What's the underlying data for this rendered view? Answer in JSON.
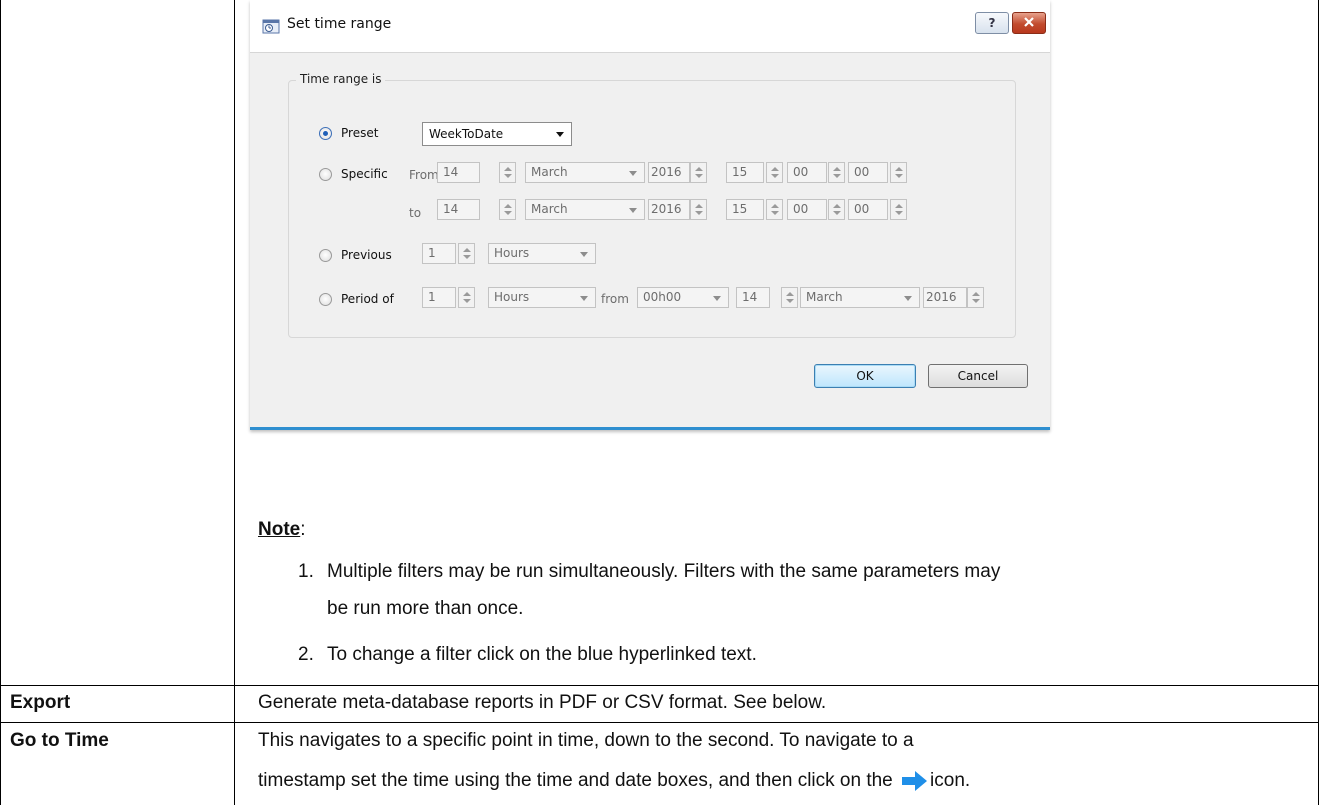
{
  "dialog": {
    "title": "Set time range",
    "group_title": "Time range is",
    "preset": {
      "label": "Preset",
      "value": "WeekToDate",
      "selected": true
    },
    "specific": {
      "label": "Specific",
      "from_label": "From",
      "to_label": "to",
      "from": {
        "day": "14",
        "month": "March",
        "year": "2016",
        "hour": "15",
        "minute": "00",
        "second": "00"
      },
      "to": {
        "day": "14",
        "month": "March",
        "year": "2016",
        "hour": "15",
        "minute": "00",
        "second": "00"
      }
    },
    "previous": {
      "label": "Previous",
      "count": "1",
      "unit": "Hours"
    },
    "period_of": {
      "label": "Period of",
      "count": "1",
      "unit": "Hours",
      "from_label": "from",
      "time": "00h00",
      "day": "14",
      "month": "March",
      "year": "2016"
    },
    "ok_label": "OK",
    "cancel_label": "Cancel",
    "help_label": "?",
    "colors": {
      "accent": "#2f8fd0",
      "close": "#c24b2e"
    }
  },
  "note": {
    "title": "Note",
    "items": [
      {
        "num": "1.",
        "line1": "Multiple filters may be run simultaneously. Filters with the same  parameters may",
        "line2": "be run more than once."
      },
      {
        "num": "2.",
        "line1": "To change a filter click on the blue hyperlinked text."
      }
    ]
  },
  "rows": [
    {
      "label": "Export",
      "text": "Generate meta-database reports in PDF or CSV format. See below."
    },
    {
      "label": "Go to Time",
      "line1": "This navigates to a specific point in time, down to the second. To navigate to a",
      "line2_before": "timestamp set the time using the time and date boxes, and then click on the",
      "line2_after": "icon.",
      "icon": "right-arrow-icon"
    }
  ]
}
